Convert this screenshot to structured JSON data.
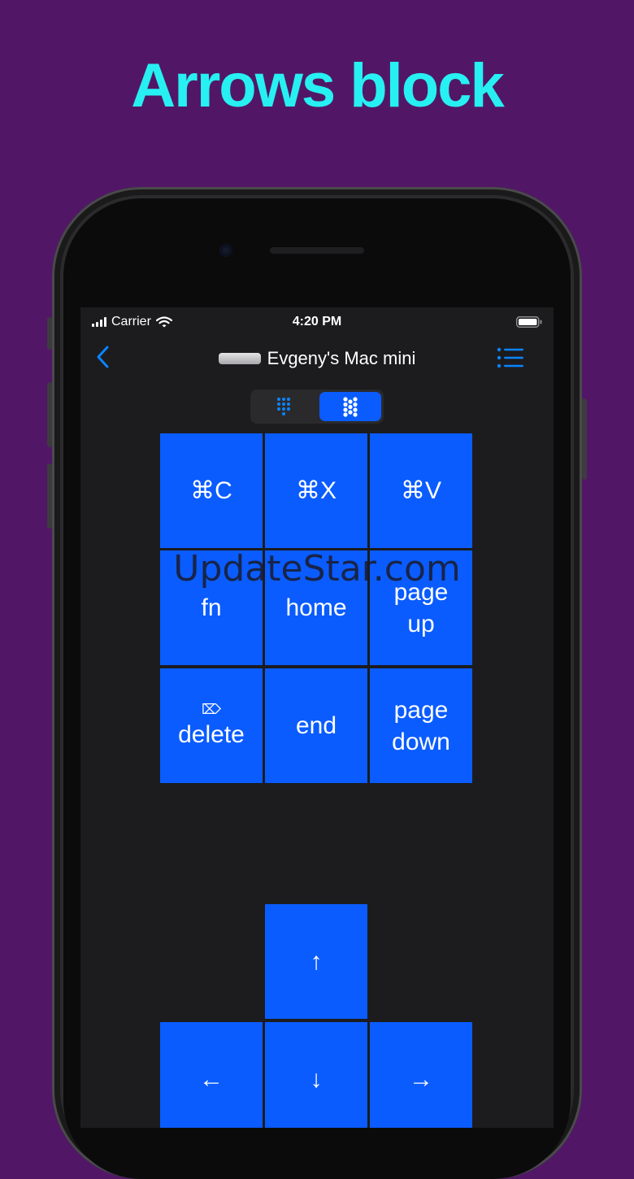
{
  "headline": "Arrows block",
  "status_bar": {
    "carrier": "Carrier",
    "time": "4:20 PM"
  },
  "nav": {
    "title": "Evgeny's Mac mini",
    "back_icon": "chevron-left-icon",
    "menu_icon": "list-icon"
  },
  "segmented_control": {
    "segments": [
      {
        "icon": "small-keypad-icon",
        "selected": false
      },
      {
        "icon": "large-keypad-icon",
        "selected": true
      }
    ]
  },
  "keys": {
    "copy": "⌘C",
    "cut": "⌘X",
    "paste": "⌘V",
    "fn": "fn",
    "home": "home",
    "page_up": "page\nup",
    "delete_symbol": "⌦",
    "delete": "delete",
    "end": "end",
    "page_down": "page\ndown",
    "up": "↑",
    "left": "←",
    "down": "↓",
    "right": "→"
  },
  "watermark": "UpdateStar.com",
  "colors": {
    "background": "#511766",
    "headline": "#27f0f2",
    "key": "#0a5cff",
    "accent": "#0a84ff"
  }
}
